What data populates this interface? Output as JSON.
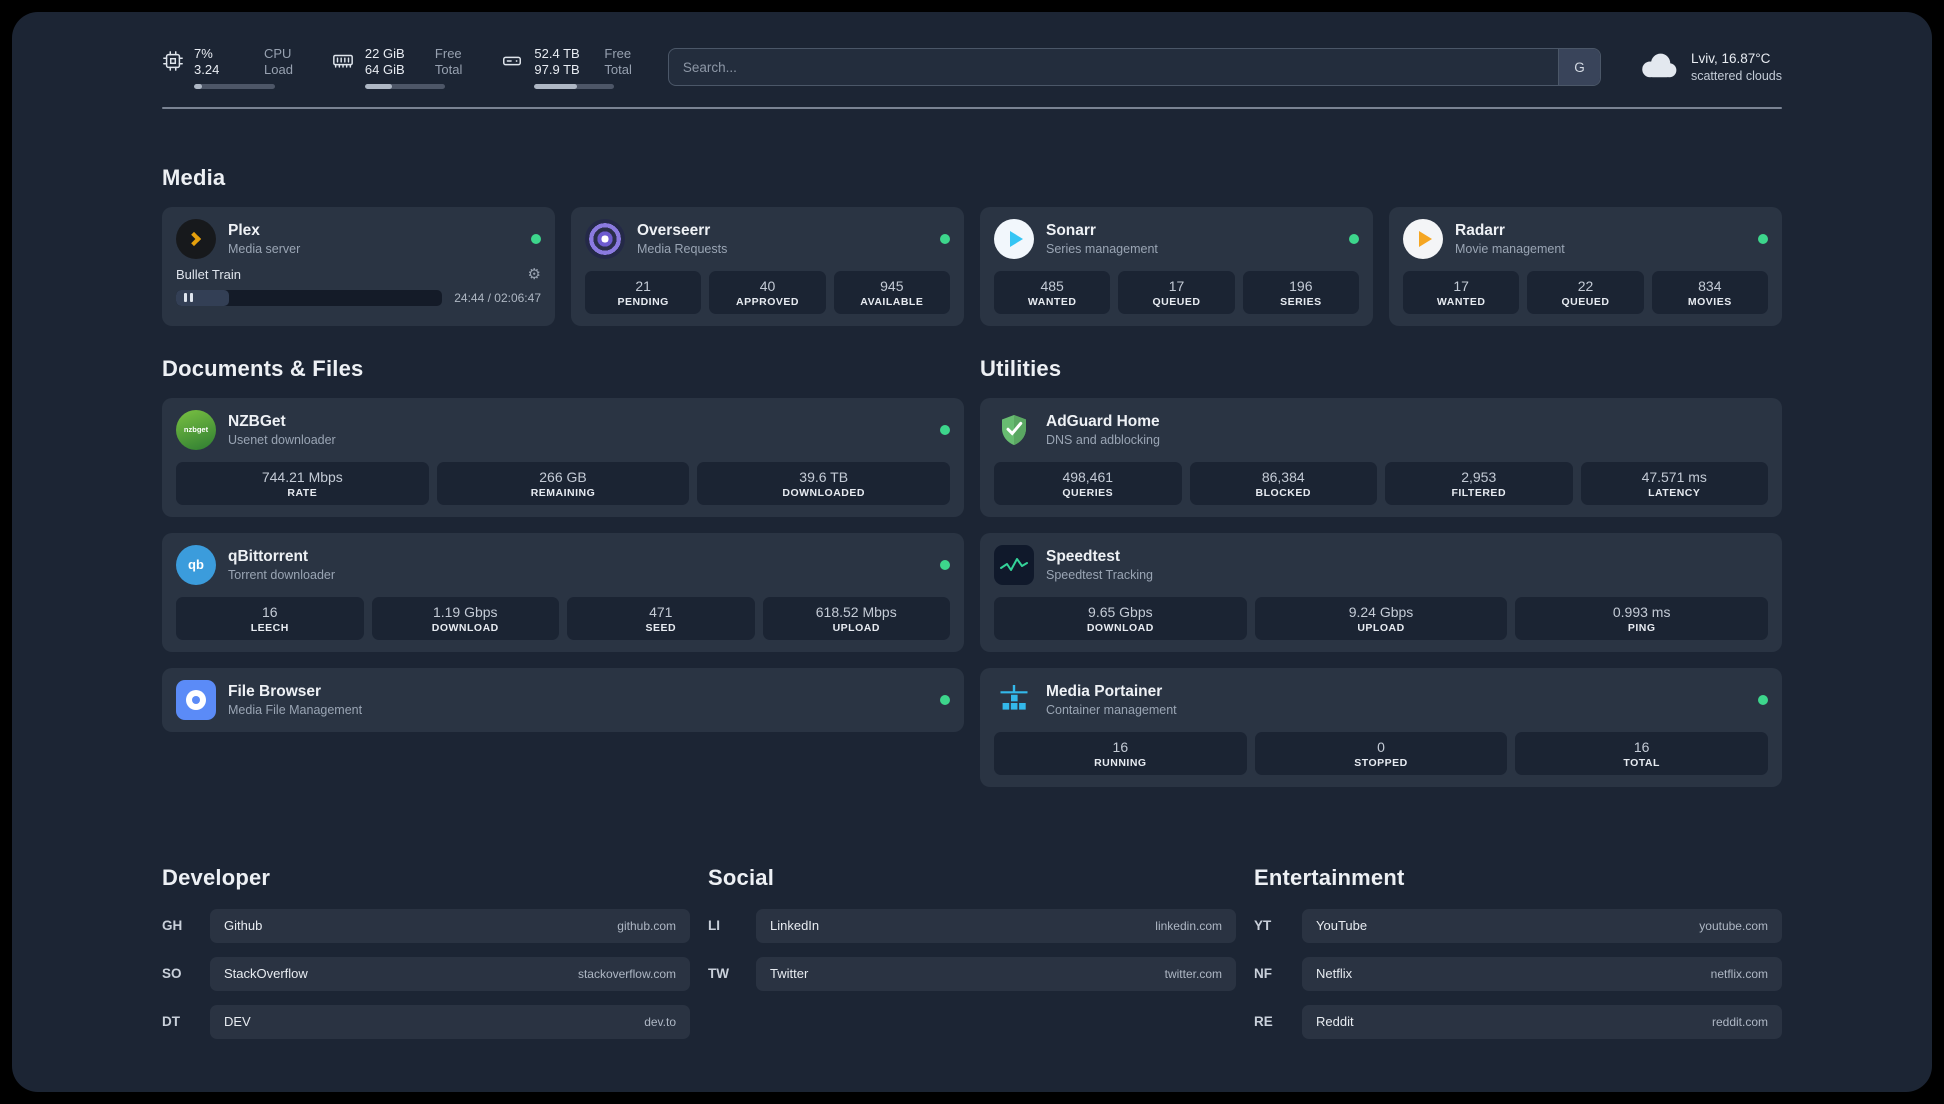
{
  "page": {
    "bg": "#1c2534",
    "card_bg": "#2a3443",
    "tile_bg": "#1b2433",
    "status_green": "#3dd68c"
  },
  "topbar": {
    "cpu": {
      "value1": "7%",
      "value2": "3.24",
      "label1": "CPU",
      "label2": "Load",
      "progress": 10
    },
    "memory": {
      "value1": "22 GiB",
      "value2": "64 GiB",
      "label1": "Free",
      "label2": "Total",
      "progress": 34
    },
    "disk": {
      "value1": "52.4 TB",
      "value2": "97.9 TB",
      "label1": "Free",
      "label2": "Total",
      "progress": 53
    },
    "search": {
      "placeholder": "Search...",
      "button_label": "G"
    },
    "weather": {
      "location": "Lviv, 16.87°C",
      "condition": "scattered clouds"
    }
  },
  "media": {
    "title": "Media",
    "plex": {
      "name": "Plex",
      "desc": "Media server",
      "now_playing": "Bullet Train",
      "time": "24:44 / 02:06:47",
      "progress": 20
    },
    "overseerr": {
      "name": "Overseerr",
      "desc": "Media Requests",
      "stats": [
        {
          "value": "21",
          "label": "PENDING"
        },
        {
          "value": "40",
          "label": "APPROVED"
        },
        {
          "value": "945",
          "label": "AVAILABLE"
        }
      ]
    },
    "sonarr": {
      "name": "Sonarr",
      "desc": "Series management",
      "stats": [
        {
          "value": "485",
          "label": "WANTED"
        },
        {
          "value": "17",
          "label": "QUEUED"
        },
        {
          "value": "196",
          "label": "SERIES"
        }
      ]
    },
    "radarr": {
      "name": "Radarr",
      "desc": "Movie management",
      "stats": [
        {
          "value": "17",
          "label": "WANTED"
        },
        {
          "value": "22",
          "label": "QUEUED"
        },
        {
          "value": "834",
          "label": "MOVIES"
        }
      ]
    }
  },
  "documents": {
    "title": "Documents & Files",
    "nzbget": {
      "name": "NZBGet",
      "desc": "Usenet downloader",
      "icon_text": "nzbget",
      "stats": [
        {
          "value": "744.21 Mbps",
          "label": "RATE"
        },
        {
          "value": "266 GB",
          "label": "REMAINING"
        },
        {
          "value": "39.6 TB",
          "label": "DOWNLOADED"
        }
      ]
    },
    "qbittorrent": {
      "name": "qBittorrent",
      "desc": "Torrent downloader",
      "icon_text": "qb",
      "stats": [
        {
          "value": "16",
          "label": "LEECH"
        },
        {
          "value": "1.19 Gbps",
          "label": "DOWNLOAD"
        },
        {
          "value": "471",
          "label": "SEED"
        },
        {
          "value": "618.52 Mbps",
          "label": "UPLOAD"
        }
      ]
    },
    "filebrowser": {
      "name": "File Browser",
      "desc": "Media File Management"
    }
  },
  "utilities": {
    "title": "Utilities",
    "adguard": {
      "name": "AdGuard Home",
      "desc": "DNS and adblocking",
      "stats": [
        {
          "value": "498,461",
          "label": "QUERIES"
        },
        {
          "value": "86,384",
          "label": "BLOCKED"
        },
        {
          "value": "2,953",
          "label": "FILTERED"
        },
        {
          "value": "47.571 ms",
          "label": "LATENCY"
        }
      ]
    },
    "speedtest": {
      "name": "Speedtest",
      "desc": "Speedtest Tracking",
      "stats": [
        {
          "value": "9.65 Gbps",
          "label": "DOWNLOAD"
        },
        {
          "value": "9.24 Gbps",
          "label": "UPLOAD"
        },
        {
          "value": "0.993 ms",
          "label": "PING"
        }
      ]
    },
    "portainer": {
      "name": "Media Portainer",
      "desc": "Container management",
      "stats": [
        {
          "value": "16",
          "label": "RUNNING"
        },
        {
          "value": "0",
          "label": "STOPPED"
        },
        {
          "value": "16",
          "label": "TOTAL"
        }
      ]
    }
  },
  "bookmarks": {
    "developer": {
      "title": "Developer",
      "items": [
        {
          "abbr": "GH",
          "name": "Github",
          "domain": "github.com"
        },
        {
          "abbr": "SO",
          "name": "StackOverflow",
          "domain": "stackoverflow.com"
        },
        {
          "abbr": "DT",
          "name": "DEV",
          "domain": "dev.to"
        }
      ]
    },
    "social": {
      "title": "Social",
      "items": [
        {
          "abbr": "LI",
          "name": "LinkedIn",
          "domain": "linkedin.com"
        },
        {
          "abbr": "TW",
          "name": "Twitter",
          "domain": "twitter.com"
        }
      ]
    },
    "entertainment": {
      "title": "Entertainment",
      "items": [
        {
          "abbr": "YT",
          "name": "YouTube",
          "domain": "youtube.com"
        },
        {
          "abbr": "NF",
          "name": "Netflix",
          "domain": "netflix.com"
        },
        {
          "abbr": "RE",
          "name": "Reddit",
          "domain": "reddit.com"
        }
      ]
    }
  }
}
